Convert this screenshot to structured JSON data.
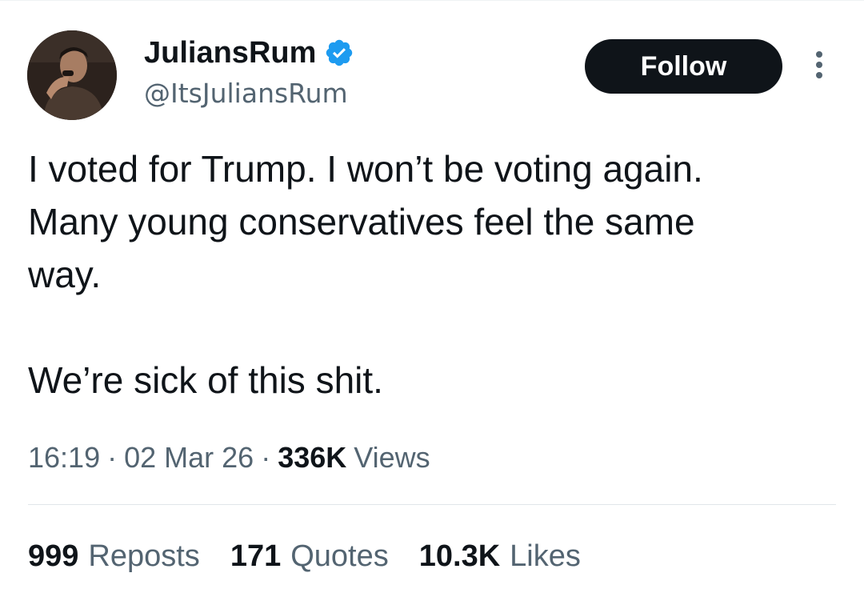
{
  "author": {
    "display_name": "JuliansRum",
    "handle": "@ItsJuliansRum",
    "verified": true,
    "avatar_icon": "user-photo-avatar"
  },
  "header": {
    "follow_label": "Follow",
    "more_icon": "more-vertical-icon"
  },
  "tweet": {
    "lines": [
      "I voted for Trump. I won’t be voting again.",
      "Many young conservatives feel the same",
      "way.",
      "We’re sick of this shit."
    ]
  },
  "meta": {
    "time": "16:19",
    "separator": "·",
    "date": "02 Mar 26",
    "views_count": "336K",
    "views_label": "Views"
  },
  "stats": {
    "reposts_count": "999",
    "reposts_label": "Reposts",
    "quotes_count": "171",
    "quotes_label": "Quotes",
    "likes_count": "10.3K",
    "likes_label": "Likes"
  },
  "colors": {
    "text_primary": "#0f1419",
    "text_secondary": "#536471",
    "verified_badge": "#1d9bf0",
    "follow_button_bg": "#0f1419",
    "follow_button_text": "#ffffff",
    "divider": "#e1e6e9"
  }
}
